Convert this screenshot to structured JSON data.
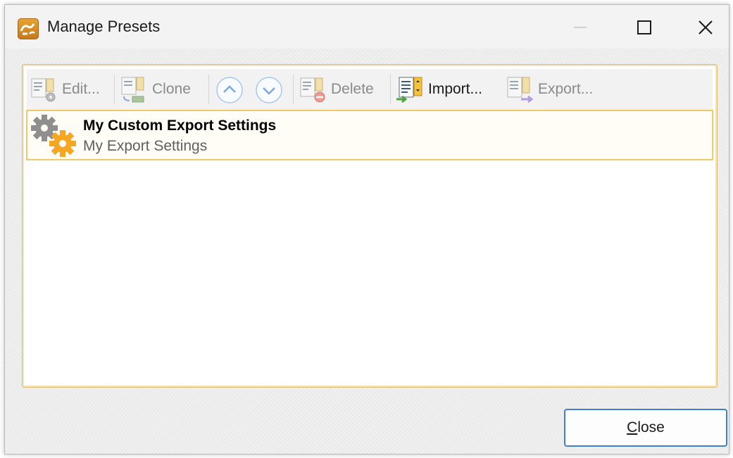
{
  "window": {
    "title": "Manage Presets"
  },
  "toolbar": {
    "edit_label": "Edit...",
    "clone_label": "Clone",
    "delete_label": "Delete",
    "import_label": "Import...",
    "export_label": "Export..."
  },
  "presets": {
    "items": [
      {
        "title": "My Custom Export Settings",
        "subtitle": "My Export Settings"
      }
    ]
  },
  "footer": {
    "close_label_accel": "C",
    "close_label_rest": "lose"
  },
  "colors": {
    "accent_border": "#f0c96a",
    "button_focus": "#3d7fd4",
    "icon_orange": "#f5a623"
  },
  "icons": [
    "app-icon",
    "minimize-icon",
    "maximize-icon",
    "close-icon",
    "edit-icon",
    "clone-icon",
    "move-up-icon",
    "move-down-icon",
    "delete-icon",
    "import-icon",
    "export-icon",
    "gear-icon"
  ]
}
